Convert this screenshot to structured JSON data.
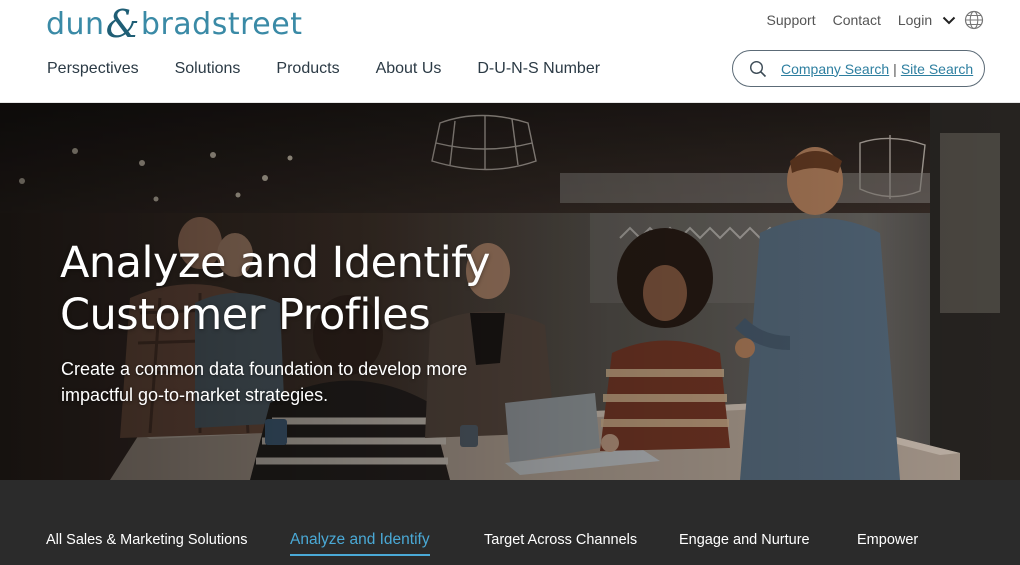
{
  "brand": {
    "logo_left": "dun",
    "logo_amp": "&",
    "logo_right": "bradstreet",
    "primary_color": "#3a8aa6",
    "accent_color": "#4aa9d6"
  },
  "utility_nav": {
    "support": "Support",
    "contact": "Contact",
    "login": "Login",
    "login_icon": "chevron-down-icon",
    "language_icon": "globe-icon"
  },
  "main_nav": {
    "items": [
      {
        "label": "Perspectives"
      },
      {
        "label": "Solutions"
      },
      {
        "label": "Products"
      },
      {
        "label": "About Us"
      },
      {
        "label": "D-U-N-S Number"
      }
    ]
  },
  "search": {
    "icon": "search-icon",
    "company_search": "Company Search",
    "separator": "|",
    "site_search": "Site Search"
  },
  "hero": {
    "title_line1": "Analyze and Identify",
    "title_line2": "Customer Profiles",
    "subtitle": "Create a common data foundation to develop more impactful go-to-market strategies."
  },
  "tabs": {
    "active_index": 1,
    "items": [
      {
        "label": "All Sales & Marketing Solutions"
      },
      {
        "label": "Analyze and Identify"
      },
      {
        "label": "Target Across Channels"
      },
      {
        "label": "Engage and Nurture"
      },
      {
        "label": "Empower"
      }
    ]
  }
}
